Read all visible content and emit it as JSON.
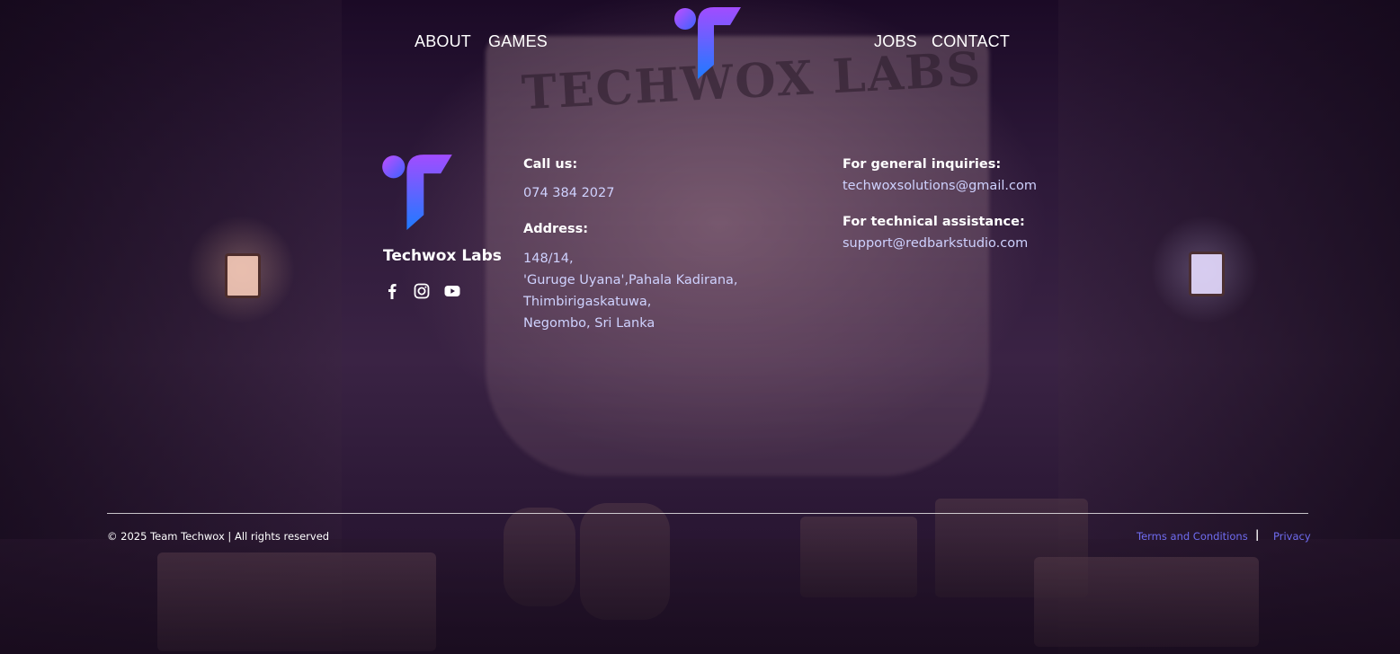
{
  "nav": {
    "left": [
      "ABOUT",
      "GAMES"
    ],
    "right": [
      "JOBS",
      "CONTACT"
    ]
  },
  "brand": {
    "name": "Techwox Labs",
    "banner_text": "TECHWOX LABS"
  },
  "social": [
    "facebook-icon",
    "instagram-icon",
    "youtube-icon"
  ],
  "contact": {
    "call_label": "Call us:",
    "phone": "074 384 2027",
    "address_label": "Address:",
    "address_lines": [
      "148/14,",
      "'Guruge Uyana',Pahala Kadirana,",
      "Thimbirigaskatuwa,",
      "Negombo, Sri Lanka"
    ],
    "general_label": "For general inquiries:",
    "general_email": "techwoxsolutions@gmail.com",
    "tech_label": "For technical assistance:",
    "tech_email": "support@redbarkstudio.com"
  },
  "footer": {
    "copyright": "© 2025 Team Techwox | All rights reserved",
    "terms": "Terms and Conditions",
    "separator": "|",
    "privacy": "Privacy"
  },
  "colors": {
    "link": "#cfd2ff",
    "legal_link": "#6f6cf0",
    "logo_start": "#a24cff",
    "logo_end": "#1e7bff"
  }
}
